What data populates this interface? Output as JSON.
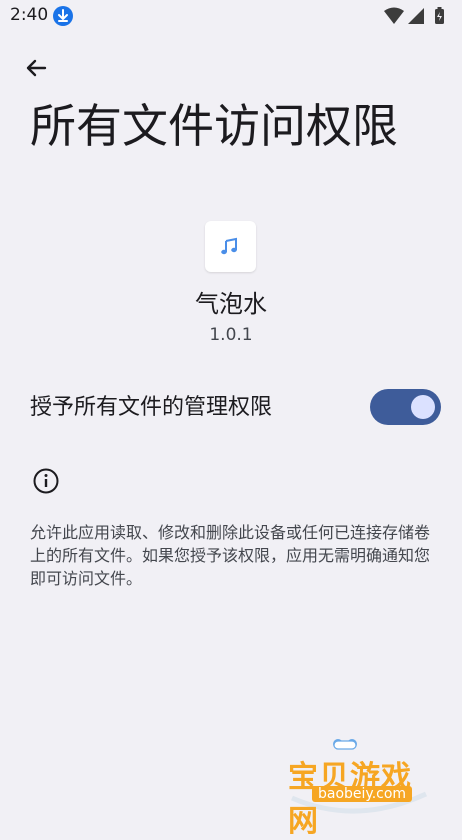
{
  "status_bar": {
    "time": "2:40"
  },
  "header": {
    "title": "所有文件访问权限"
  },
  "app": {
    "name": "气泡水",
    "version": "1.0.1"
  },
  "permission": {
    "label": "授予所有文件的管理权限",
    "enabled": true
  },
  "info": {
    "description": "允许此应用读取、修改和删除此设备或任何已连接存储卷上的所有文件。如果您授予该权限，应用无需明确通知您即可访问文件。"
  },
  "watermark": {
    "text": "宝贝游戏网",
    "url": "baobeiy.com"
  }
}
